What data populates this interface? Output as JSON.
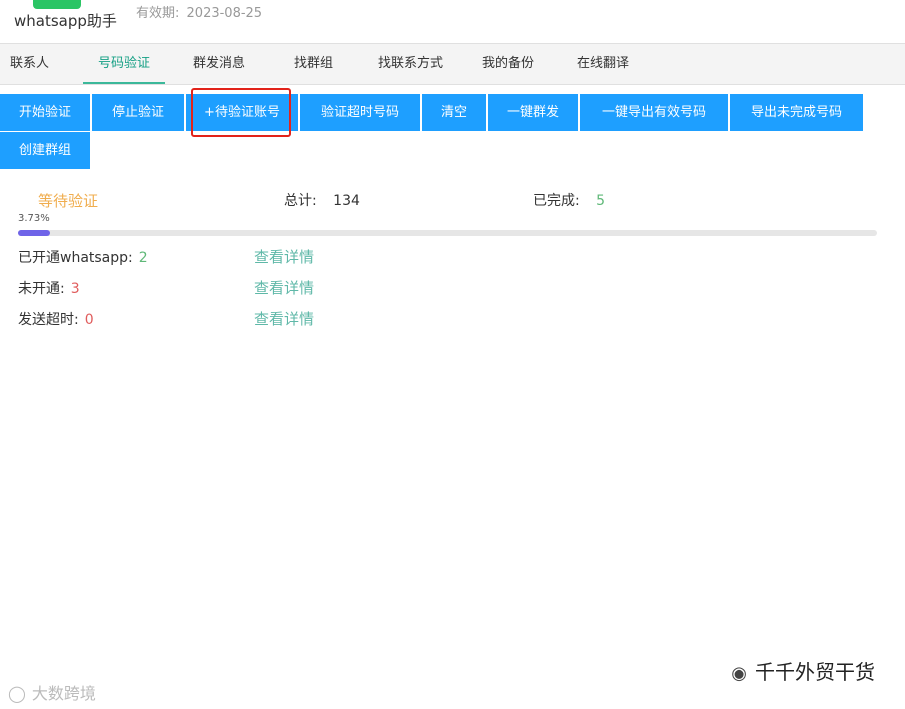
{
  "app": {
    "name": "whatsapp助手",
    "expiry_label": "有效期:",
    "expiry_date": "2023-08-25"
  },
  "nav": {
    "tabs": [
      {
        "label": "联系人"
      },
      {
        "label": "号码验证"
      },
      {
        "label": "群发消息"
      },
      {
        "label": "找群组"
      },
      {
        "label": "找联系方式"
      },
      {
        "label": "我的备份"
      },
      {
        "label": "在线翻译"
      }
    ],
    "active": "号码验证"
  },
  "toolbar": {
    "buttons": [
      {
        "label": "开始验证"
      },
      {
        "label": "停止验证"
      },
      {
        "label": "+待验证账号"
      },
      {
        "label": "验证超时号码"
      },
      {
        "label": "清空"
      },
      {
        "label": "一键群发"
      },
      {
        "label": "一键导出有效号码"
      },
      {
        "label": "导出未完成号码"
      },
      {
        "label": "创建群组"
      }
    ],
    "highlighted": "+待验证账号"
  },
  "status": {
    "state": "等待验证",
    "total_label": "总计:",
    "total": "134",
    "done_label": "已完成:",
    "done": "5",
    "progress_text": "3.73%",
    "progress": 0.0373
  },
  "results": [
    {
      "label": "已开通whatsapp:",
      "value": "2",
      "link": "查看详情"
    },
    {
      "label": "未开通:",
      "value": "3",
      "link": "查看详情"
    },
    {
      "label": "发送超时:",
      "value": "0",
      "link": "查看详情"
    }
  ],
  "watermarks": {
    "wechat": "千千外贸干货",
    "corner": "大数跨境"
  },
  "colors": {
    "primary": "#1e9fff",
    "active_tab": "#16a085",
    "progress": "#6f64e8",
    "highlight": "#e2231a"
  }
}
